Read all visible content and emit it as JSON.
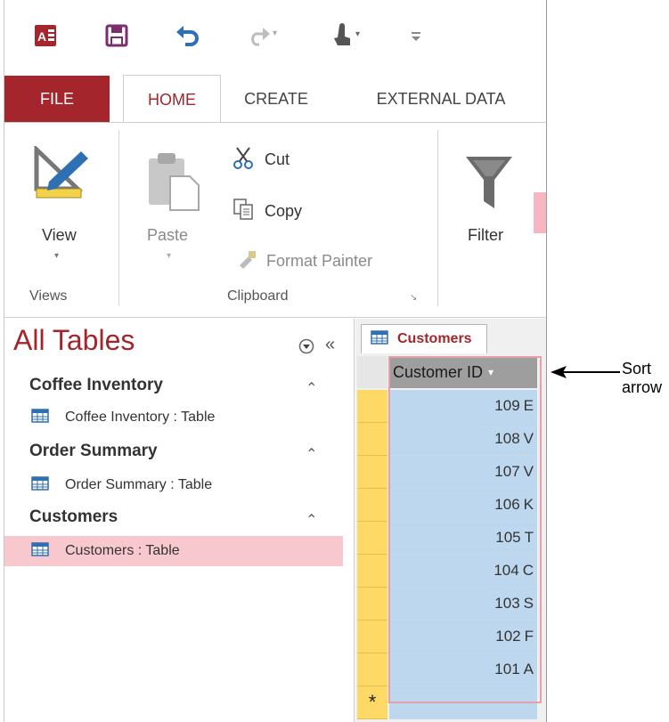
{
  "qat": {
    "icons": [
      "access-icon",
      "save-icon",
      "undo-icon",
      "redo-icon",
      "touch-mode-icon",
      "customize-icon"
    ]
  },
  "tabs": [
    {
      "label": "FILE"
    },
    {
      "label": "HOME"
    },
    {
      "label": "CREATE"
    },
    {
      "label": "EXTERNAL DATA"
    }
  ],
  "ribbon": {
    "view_label": "View",
    "paste_label": "Paste",
    "cut_label": "Cut",
    "copy_label": "Copy",
    "format_painter_label": "Format Painter",
    "filter_label": "Filter",
    "groups": {
      "views": "Views",
      "clipboard": "Clipboard"
    }
  },
  "nav": {
    "title": "All Tables",
    "groups": [
      {
        "name": "Coffee Inventory",
        "item": "Coffee Inventory : Table"
      },
      {
        "name": "Order Summary",
        "item": "Order Summary : Table"
      },
      {
        "name": "Customers",
        "item": "Customers : Table"
      }
    ]
  },
  "datasheet": {
    "tab": "Customers",
    "column_header": "Customer ID",
    "rows": [
      "109",
      "108",
      "107",
      "106",
      "105",
      "104",
      "103",
      "102",
      "101"
    ],
    "new_row_marker": "*",
    "partial_letters": [
      "E",
      "V",
      "V",
      "K",
      "T",
      "C",
      "S",
      "F",
      "A"
    ]
  },
  "annotation": {
    "text": "Sort arrow"
  },
  "colors": {
    "access_red": "#a4262c",
    "selection_blue": "#bdd7ee",
    "row_selector_yellow": "#ffd966",
    "highlight_pink": "#f8c8cf"
  }
}
